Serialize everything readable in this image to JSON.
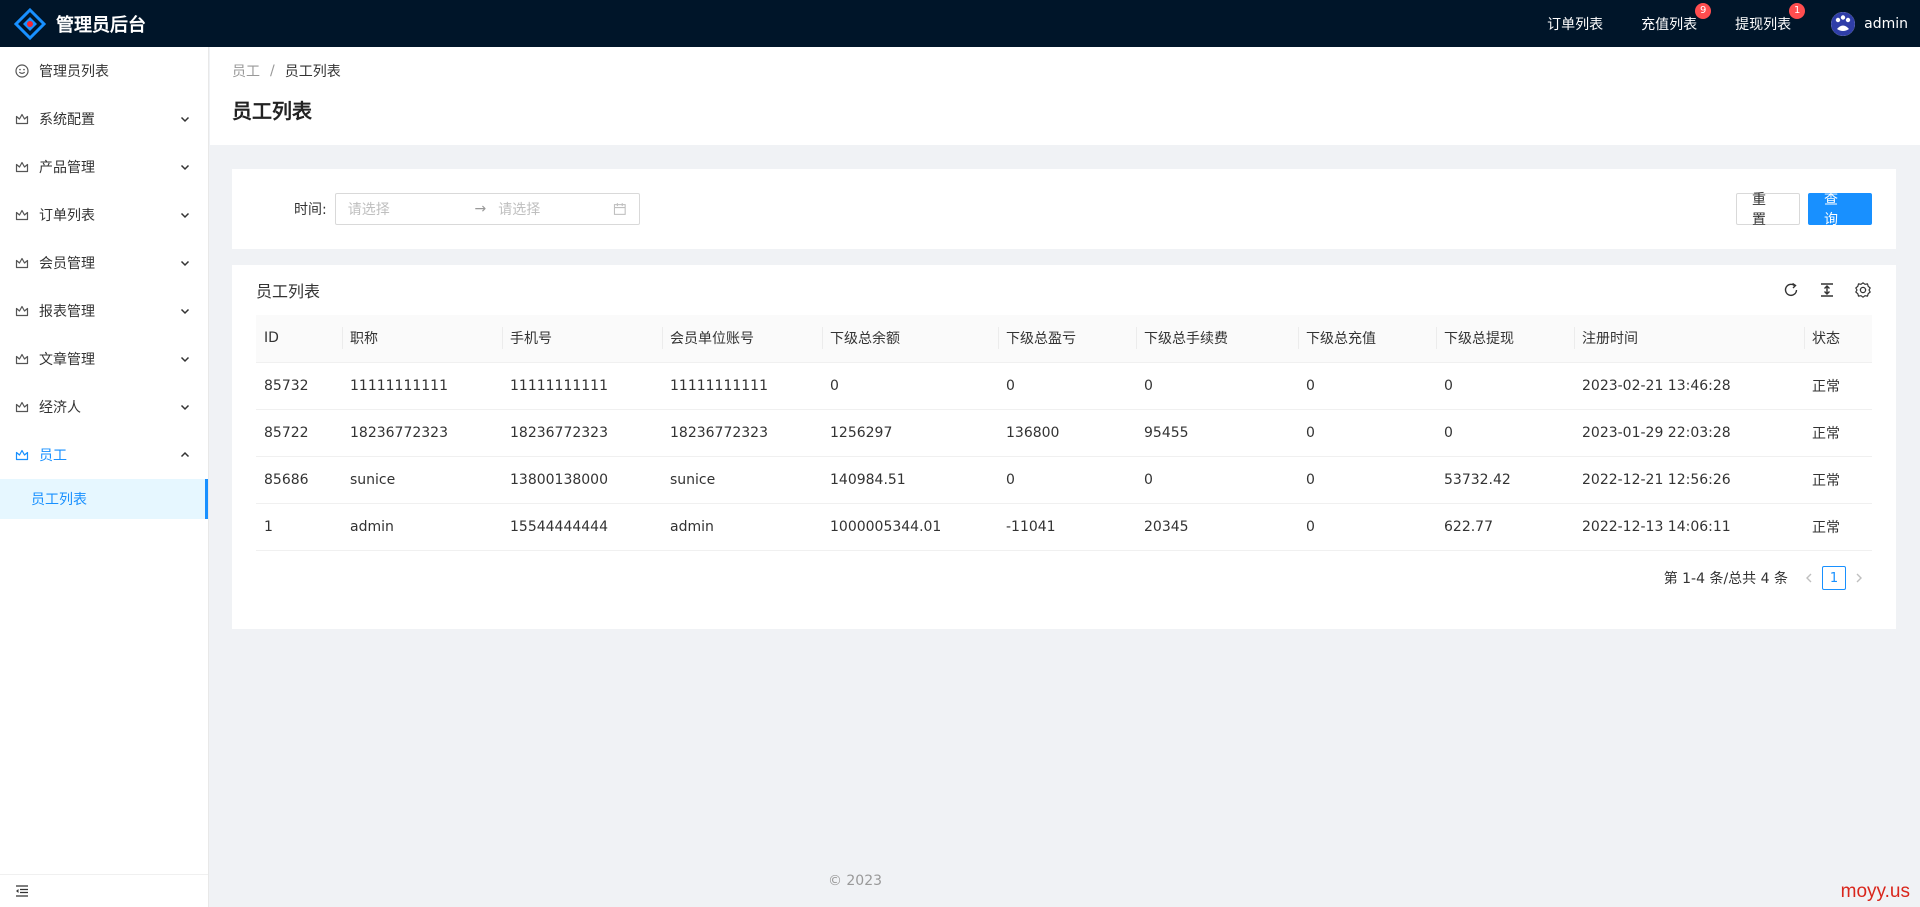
{
  "app": {
    "title": "管理员后台"
  },
  "header": {
    "nav": [
      {
        "label": "订单列表",
        "badge": ""
      },
      {
        "label": "充值列表",
        "badge": "9"
      },
      {
        "label": "提现列表",
        "badge": "1"
      }
    ],
    "user": {
      "name": "admin",
      "avatar_icon": "avatar-icon"
    }
  },
  "sidebar": {
    "items": [
      {
        "label": "管理员列表",
        "icon": "smile-icon",
        "has_children": false
      },
      {
        "label": "系统配置",
        "icon": "crown-icon",
        "has_children": true
      },
      {
        "label": "产品管理",
        "icon": "crown-icon",
        "has_children": true
      },
      {
        "label": "订单列表",
        "icon": "crown-icon",
        "has_children": true
      },
      {
        "label": "会员管理",
        "icon": "crown-icon",
        "has_children": true
      },
      {
        "label": "报表管理",
        "icon": "crown-icon",
        "has_children": true
      },
      {
        "label": "文章管理",
        "icon": "crown-icon",
        "has_children": true
      },
      {
        "label": "经济人",
        "icon": "crown-icon",
        "has_children": true
      },
      {
        "label": "员工",
        "icon": "crown-icon",
        "has_children": true,
        "open": true
      }
    ],
    "active_sub": "员工列表",
    "collapse_icon": "menu-fold-icon"
  },
  "breadcrumb": {
    "parent": "员工",
    "separator": "/",
    "current": "员工列表"
  },
  "page": {
    "title": "员工列表"
  },
  "search": {
    "label": "时间:",
    "start_placeholder": "请选择",
    "end_placeholder": "请选择",
    "arrow": "→",
    "reset": "重置",
    "query": "查询"
  },
  "table": {
    "title": "员工列表",
    "tools": [
      "reload-icon",
      "density-icon",
      "setting-icon"
    ],
    "columns": [
      "ID",
      "职称",
      "手机号",
      "会员单位账号",
      "下级总余额",
      "下级总盈亏",
      "下级总手续费",
      "下级总充值",
      "下级总提现",
      "注册时间",
      "状态"
    ],
    "rows": [
      [
        "85732",
        "11111111111",
        "11111111111",
        "11111111111",
        "0",
        "0",
        "0",
        "0",
        "0",
        "2023-02-21 13:46:28",
        "正常"
      ],
      [
        "85722",
        "18236772323",
        "18236772323",
        "18236772323",
        "1256297",
        "136800",
        "95455",
        "0",
        "0",
        "2023-01-29 22:03:28",
        "正常"
      ],
      [
        "85686",
        "sunice",
        "13800138000",
        "sunice",
        "140984.51",
        "0",
        "0",
        "0",
        "53732.42",
        "2022-12-21 12:56:26",
        "正常"
      ],
      [
        "1",
        "admin",
        "15544444444",
        "admin",
        "1000005344.01",
        "-11041",
        "20345",
        "0",
        "622.77",
        "2022-12-13 14:06:11",
        "正常"
      ]
    ]
  },
  "pagination": {
    "summary": "第 1-4 条/总共 4 条",
    "current": "1"
  },
  "footer": {
    "copyright": "© 2023"
  },
  "watermark": "moyy.us",
  "colors": {
    "header_bg": "#001529",
    "primary": "#1890ff",
    "badge": "#ff4d4f",
    "content_bg": "#f0f2f5"
  }
}
